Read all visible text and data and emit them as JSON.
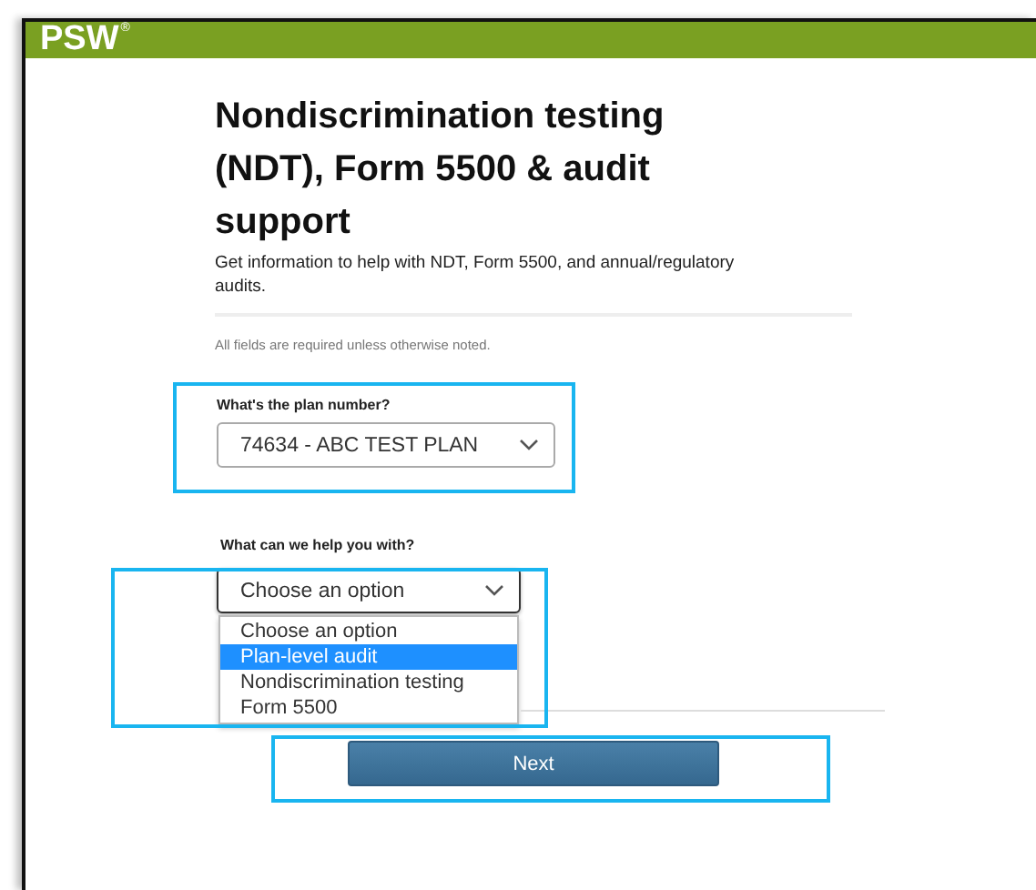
{
  "header": {
    "logo": "PSW",
    "logo_mark": "®"
  },
  "title": "Nondiscrimination testing (NDT), Form 5500 & audit support",
  "subtitle": "Get information to help with NDT, Form 5500, and annual/regulatory audits.",
  "note": "All fields are required unless otherwise noted.",
  "fields": [
    {
      "label": "What's the plan number?",
      "value": "74634 - ABC TEST PLAN",
      "expanded": false,
      "highlighted": true
    },
    {
      "label": "What can we help you with?",
      "value": "Choose an option",
      "expanded": true,
      "highlighted": true,
      "options": [
        {
          "label": "Choose an option",
          "highlighted": false
        },
        {
          "label": "Plan-level audit",
          "highlighted": true
        },
        {
          "label": "Nondiscrimination testing",
          "highlighted": false
        },
        {
          "label": "Form 5500",
          "highlighted": false
        }
      ]
    }
  ],
  "next_button": {
    "label": "Next",
    "highlighted": true
  }
}
